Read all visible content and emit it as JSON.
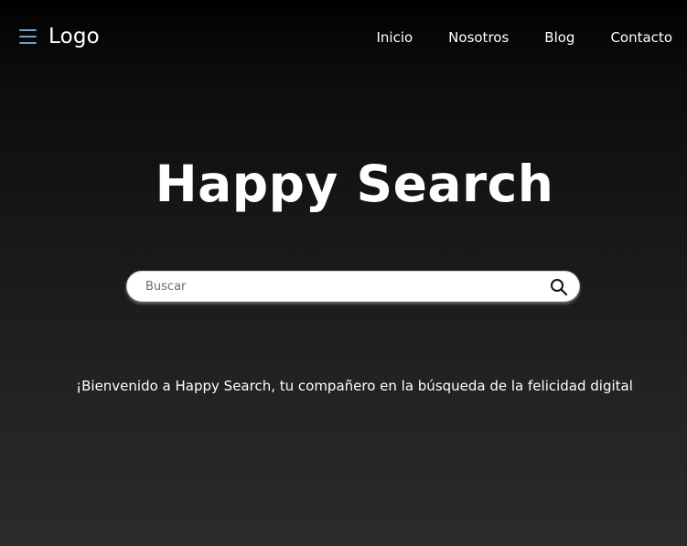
{
  "header": {
    "menu_icon": "hamburger-menu-icon",
    "logo": "Logo",
    "nav": [
      {
        "label": "Inicio"
      },
      {
        "label": "Nosotros"
      },
      {
        "label": "Blog"
      },
      {
        "label": "Contacto"
      }
    ]
  },
  "hero": {
    "title": "Happy Search"
  },
  "search": {
    "placeholder": "Buscar",
    "value": "",
    "icon": "search-icon"
  },
  "welcome": {
    "text": "¡Bienvenido a Happy Search, tu compañero en la búsqueda de la felicidad digital"
  },
  "colors": {
    "menu_icon": "#6f9fc9",
    "text": "#ffffff",
    "search_background": "#ffffff"
  }
}
